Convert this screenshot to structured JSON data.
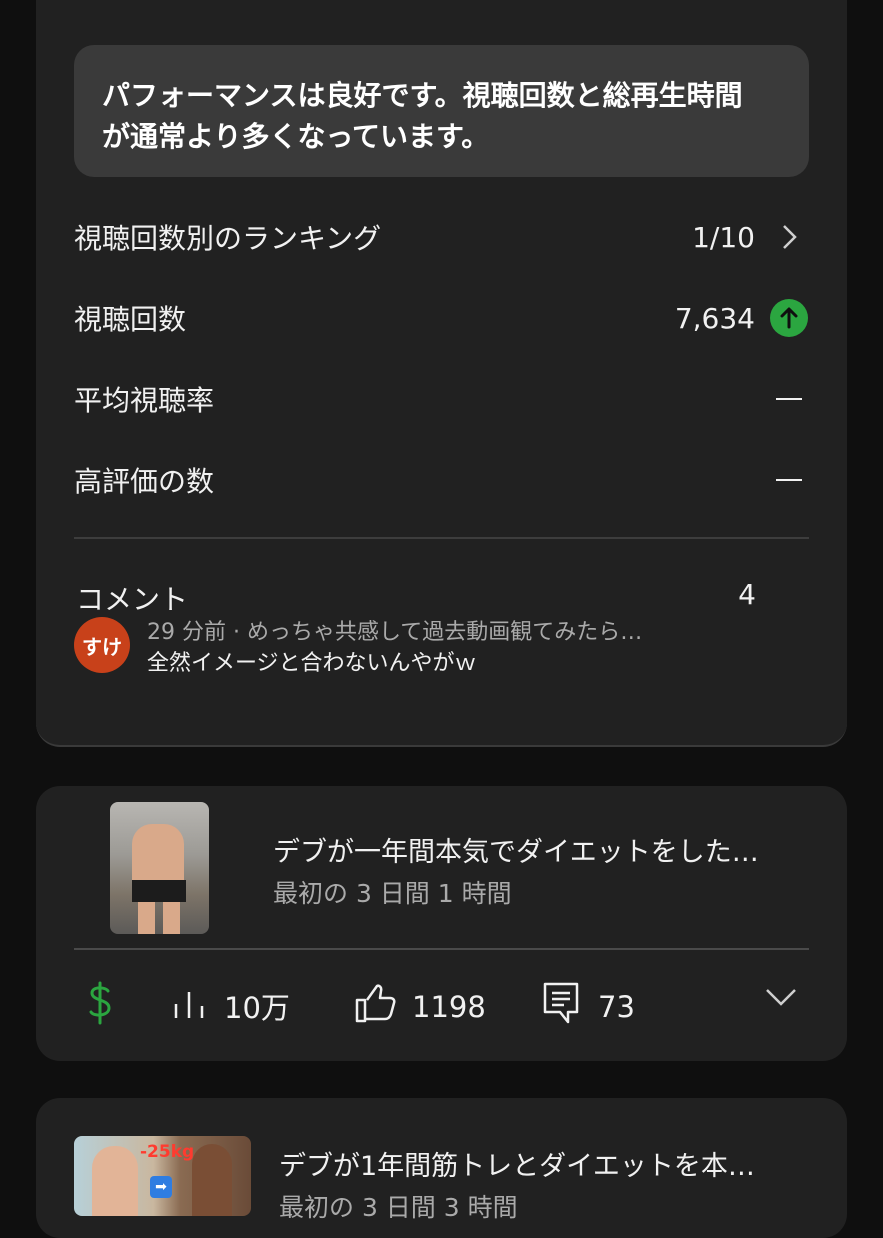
{
  "insight": {
    "line1": "パフォーマンスは良好です。視聴回数と総再生時間",
    "line2": "が通常より多くなっています。"
  },
  "metrics": [
    {
      "label": "視聴回数別のランキング",
      "value": "1/10",
      "icon": "chevron-right-icon"
    },
    {
      "label": "視聴回数",
      "value": "7,634",
      "icon": "arrow-up-icon",
      "icon_color": "#2ba640"
    },
    {
      "label": "平均視聴率",
      "value": "—"
    },
    {
      "label": "高評価の数",
      "value": "—"
    }
  ],
  "comments": {
    "label": "コメント",
    "count": "4",
    "latest": {
      "avatar_text": "すけ",
      "avatar_color": "#c8411a",
      "meta": "29 分前 · めっちゃ共感して過去動画観てみたら…",
      "text": "全然イメージと合わないんやがｗ"
    }
  },
  "videos": [
    {
      "title": "デブが一年間本気でダイエットをした…",
      "subtitle": "最初の 3 日間 1 時間",
      "monetization_icon": "dollar-icon",
      "views": "10万",
      "likes": "1198",
      "comments": "73"
    },
    {
      "title": "デブが1年間筋トレとダイエットを本…",
      "subtitle": "最初の 3 日間 3 時間",
      "thumb_text": "-25kg"
    }
  ]
}
